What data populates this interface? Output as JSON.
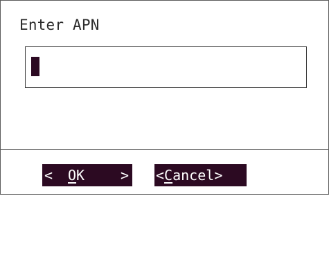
{
  "dialog": {
    "title": "Enter APN",
    "input": {
      "value": ""
    }
  },
  "buttons": {
    "ok": {
      "left_marker": "<",
      "hotkey": "O",
      "rest": "K",
      "right_marker": ">"
    },
    "cancel": {
      "open": "<",
      "hotkey": "C",
      "rest": "ancel",
      "close": ">"
    }
  },
  "colors": {
    "selection": "#2c0a22",
    "text": "#2b2b2b",
    "background": "#ffffff"
  }
}
